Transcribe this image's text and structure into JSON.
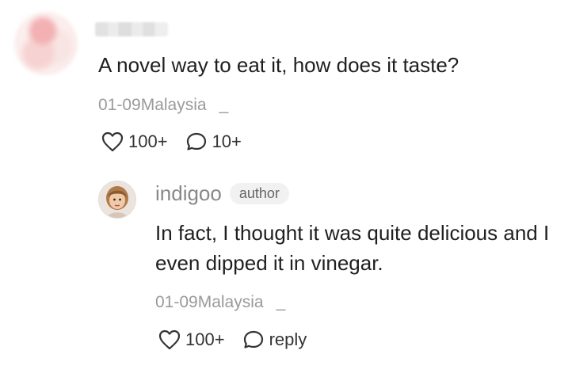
{
  "comment": {
    "text": "A novel way to eat it, how does it taste?",
    "date_location": "01-09Malaysia",
    "more": "_",
    "like_count": "100+",
    "reply_count": "10+"
  },
  "reply": {
    "username": "indigoo",
    "badge": "author",
    "text": "In fact, I thought it was quite delicious and I even dipped it in vinegar.",
    "date_location": "01-09Malaysia",
    "more": "_",
    "like_count": "100+",
    "reply_label": "reply"
  },
  "icons": {
    "like": "heart-icon",
    "comment": "comment-bubble-icon"
  }
}
